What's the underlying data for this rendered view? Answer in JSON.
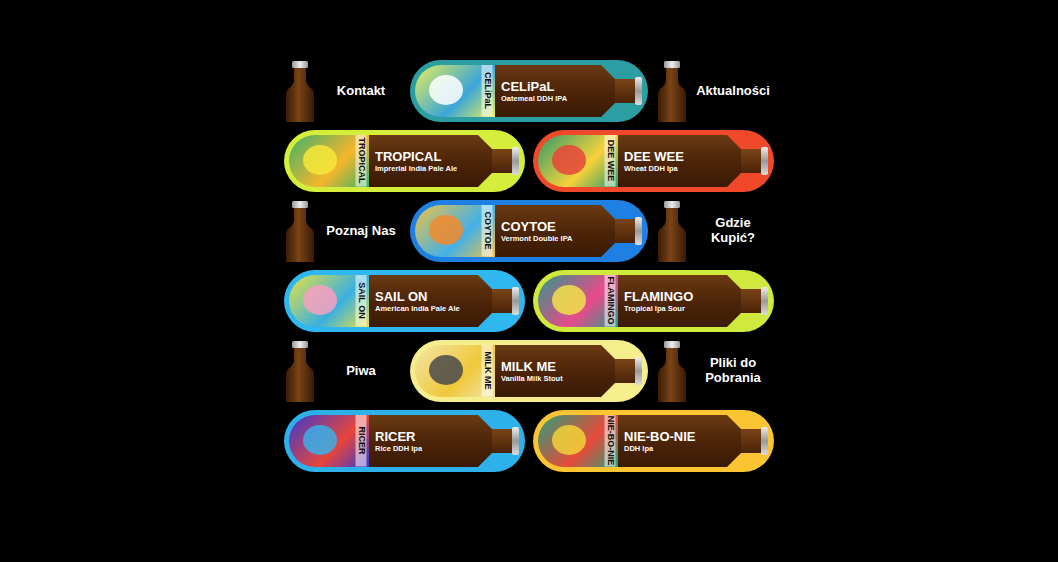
{
  "rows": [
    {
      "items": [
        {
          "kind": "nav",
          "label": "Kontakt"
        },
        {
          "kind": "beer",
          "name": "CELiPaL",
          "style": "Oatemeal DDH IPA",
          "color": "#2a9ea3"
        },
        {
          "kind": "nav",
          "label": "Aktualności"
        }
      ]
    },
    {
      "items": [
        {
          "kind": "beer",
          "name": "TROPICAL",
          "style": "Imprerial India Pale Ale",
          "color": "#d4ee3b"
        },
        {
          "kind": "beer",
          "name": "DEE WEE",
          "style": "Wheat DDH Ipa",
          "color": "#f0492a"
        }
      ]
    },
    {
      "items": [
        {
          "kind": "nav",
          "label": "Poznaj Nas"
        },
        {
          "kind": "beer",
          "name": "COYTOE",
          "style": "Vermont Double IPA",
          "color": "#1f80e3"
        },
        {
          "kind": "nav",
          "label": "Gdzie Kupić?"
        }
      ]
    },
    {
      "items": [
        {
          "kind": "beer",
          "name": "SAIL ON",
          "style": "American India Pale Ale",
          "color": "#2fb8ef"
        },
        {
          "kind": "beer",
          "name": "FLAMINGO",
          "style": "Tropical Ipa Sour",
          "color": "#cfe93c"
        }
      ]
    },
    {
      "items": [
        {
          "kind": "nav",
          "label": "Piwa"
        },
        {
          "kind": "beer",
          "name": "MILK ME",
          "style": "Vanilla Milk Stout",
          "color": "#f6ee8c"
        },
        {
          "kind": "nav",
          "label": "Pliki do Pobrania"
        }
      ]
    },
    {
      "items": [
        {
          "kind": "beer",
          "name": "RICER",
          "style": "Rice DDH Ipa",
          "color": "#2cb1ea"
        },
        {
          "kind": "beer",
          "name": "NIE-BO-NIE",
          "style": "DDH Ipa",
          "color": "#fbc433"
        }
      ]
    }
  ]
}
